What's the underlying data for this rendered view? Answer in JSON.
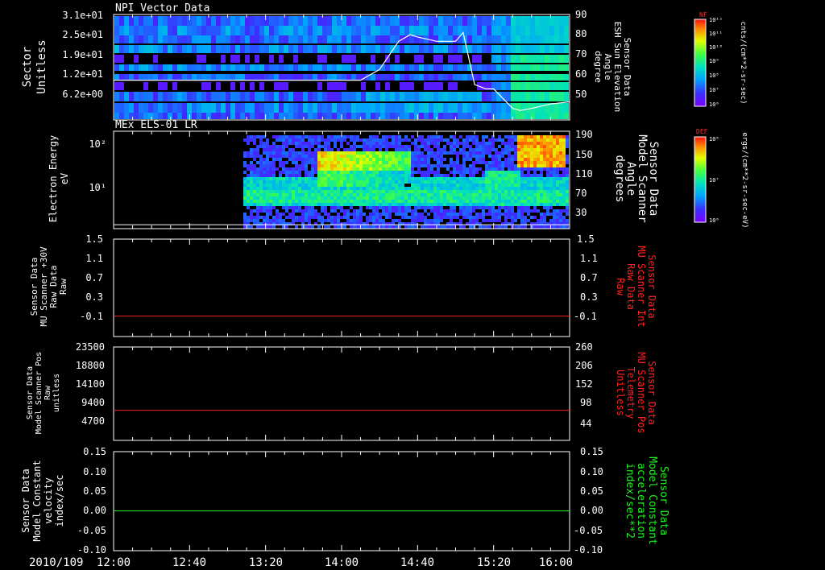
{
  "colors": {
    "background": "#000000",
    "frame": "#ffffff",
    "red_trace": "#ff2020",
    "green_trace": "#20ff20",
    "red_label": "#ff2020",
    "green_label": "#22ee22"
  },
  "chart_data": [
    {
      "id": "npi",
      "type": "heatmap",
      "title": "NPI Vector Data",
      "ylabel": [
        "Sector",
        "Unitless"
      ],
      "yticks": [
        "3.1e+01",
        "2.5e+01",
        "1.9e+01",
        "1.2e+01",
        "6.2e+00"
      ],
      "right_ylabel": [
        "Sensor Data",
        "ESH Sun Elevation",
        "Angle",
        "degree"
      ],
      "right_yticks": [
        90,
        80,
        70,
        60,
        50
      ],
      "right_ylim": [
        42,
        90
      ],
      "overlay_line": {
        "x": [
          "12:00",
          "13:30",
          "14:10",
          "14:20",
          "14:30",
          "14:36",
          "14:40",
          "14:50",
          "15:00",
          "15:04",
          "15:10",
          "15:16",
          "15:20",
          "15:30",
          "15:34",
          "15:40",
          "15:50",
          "16:00"
        ],
        "y": [
          60,
          60,
          60,
          65,
          78,
          81,
          80,
          78,
          78,
          82,
          58,
          56,
          56,
          47,
          46,
          47,
          49,
          50
        ]
      },
      "colorbar": {
        "label": "NF",
        "units": "cnts/(cm**2-sr-sec)",
        "ticks": [
          "10¹²",
          "10¹¹",
          "10¹⁰",
          "10⁹",
          "10⁸",
          "10⁷",
          "10⁶"
        ]
      }
    },
    {
      "id": "els",
      "type": "heatmap",
      "title": "MEx ELS-01 LR",
      "ylabel": [
        "Electron Energy",
        "eV"
      ],
      "yticks": [
        "10²",
        "10¹"
      ],
      "right_ylabel": [
        "Sensor Data",
        "Model Scanner",
        "Angle",
        "degrees"
      ],
      "right_yticks": [
        190,
        150,
        110,
        70,
        30
      ],
      "right_ylim": [
        5,
        190
      ],
      "overlay_line": {
        "x": [
          "12:00",
          "16:00"
        ],
        "y": [
          11,
          11
        ]
      },
      "colorbar": {
        "label": "DEF",
        "units": "ergs/(cm**2-sr-sec-eV)",
        "ticks": [
          "10⁸",
          "10⁷",
          "10⁶"
        ]
      }
    },
    {
      "id": "mu_int",
      "type": "line",
      "ylabel": [
        "Sensor Data",
        "MU Scanner +30V",
        "Raw Data",
        "Raw"
      ],
      "yticks": [
        "1.5",
        "1.1",
        "0.7",
        "0.3",
        "-0.1"
      ],
      "ylim": [
        -0.35,
        1.5
      ],
      "right_ylabel": [
        "Sensor Data",
        "MU Scanner Int",
        "Raw Data",
        "Raw"
      ],
      "right_yticks": [
        "1.5",
        "1.1",
        "0.7",
        "0.3",
        "-0.1"
      ],
      "series": [
        {
          "x": [
            "12:00",
            "16:00"
          ],
          "y": [
            0.03,
            0.03
          ]
        }
      ]
    },
    {
      "id": "mu_pos",
      "type": "line",
      "ylabel": [
        "Sensor Data",
        "Model Scanner Pos",
        "Raw",
        "unitless"
      ],
      "yticks": [
        "23500",
        "18800",
        "14100",
        "9400",
        "4700"
      ],
      "ylim": [
        0,
        23500
      ],
      "right_ylabel": [
        "Sensor Data",
        "MU Scanner Pos",
        "Telemetry",
        "Unitless"
      ],
      "right_yticks": [
        "260",
        "206",
        "152",
        "98",
        "44"
      ],
      "series": [
        {
          "x": [
            "12:00",
            "16:00"
          ],
          "y": [
            7500,
            7500
          ]
        }
      ]
    },
    {
      "id": "constant",
      "type": "line",
      "ylabel": [
        "Sensor Data",
        "Model Constant",
        "velocity",
        "index/sec"
      ],
      "yticks": [
        "0.15",
        "0.10",
        "0.05",
        "0.00",
        "-0.05",
        "-0.10"
      ],
      "ylim": [
        -0.1,
        0.15
      ],
      "right_ylabel": [
        "Sensor Data",
        "Model Constant",
        "acceleration",
        "index/sec**2"
      ],
      "right_yticks": [
        "0.15",
        "0.10",
        "0.05",
        "0.00",
        "-0.05",
        "-0.10"
      ],
      "series": [
        {
          "x": [
            "12:00",
            "16:00"
          ],
          "y": [
            0.0,
            0.0
          ]
        }
      ]
    }
  ],
  "x_axis": {
    "date_label": "2010/109",
    "tick_labels": [
      "12:00",
      "12:40",
      "13:20",
      "14:00",
      "14:40",
      "15:20",
      "16:00"
    ],
    "range": [
      "12:00",
      "16:00"
    ]
  }
}
